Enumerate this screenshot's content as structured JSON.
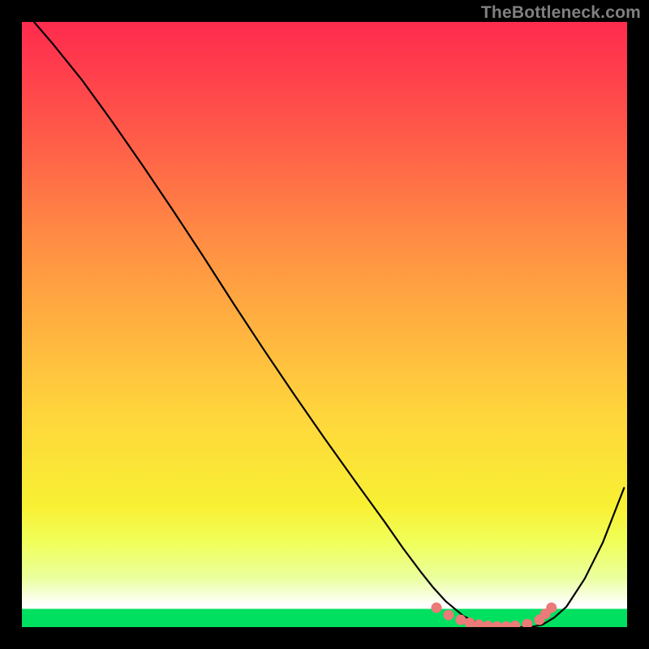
{
  "watermark": "TheBottleneck.com",
  "chart_data": {
    "type": "line",
    "title": "",
    "xlabel": "",
    "ylabel": "",
    "xlim": [
      0,
      100
    ],
    "ylim": [
      0,
      100
    ],
    "grid": false,
    "legend": false,
    "series": [
      {
        "name": "bottleneck-curve",
        "x": [
          2,
          5,
          10,
          15,
          20,
          25,
          30,
          35,
          40,
          45,
          50,
          55,
          60,
          63,
          66,
          68,
          70,
          73,
          76,
          79,
          82,
          84,
          86,
          88,
          90,
          93,
          96,
          99.5
        ],
        "y": [
          100,
          96.5,
          90.3,
          83.4,
          76.2,
          68.8,
          61.2,
          53.4,
          45.8,
          38.4,
          31.2,
          24.2,
          17.3,
          13.0,
          9.0,
          6.5,
          4.3,
          1.8,
          0.4,
          0.0,
          0.0,
          0.0,
          0.4,
          1.6,
          3.4,
          8.0,
          14.0,
          23.0
        ]
      }
    ],
    "markers": {
      "name": "optimal-range",
      "color": "#eb7a78",
      "x": [
        68.5,
        70.5,
        72.5,
        74,
        75.5,
        77,
        78.5,
        80,
        81.5,
        83.5,
        85.5,
        86.5,
        87.5
      ],
      "y": [
        3.2,
        2.0,
        1.2,
        0.7,
        0.4,
        0.2,
        0.1,
        0.1,
        0.2,
        0.5,
        1.2,
        2.2,
        3.2
      ]
    },
    "background": "red-yellow-green-gradient"
  }
}
